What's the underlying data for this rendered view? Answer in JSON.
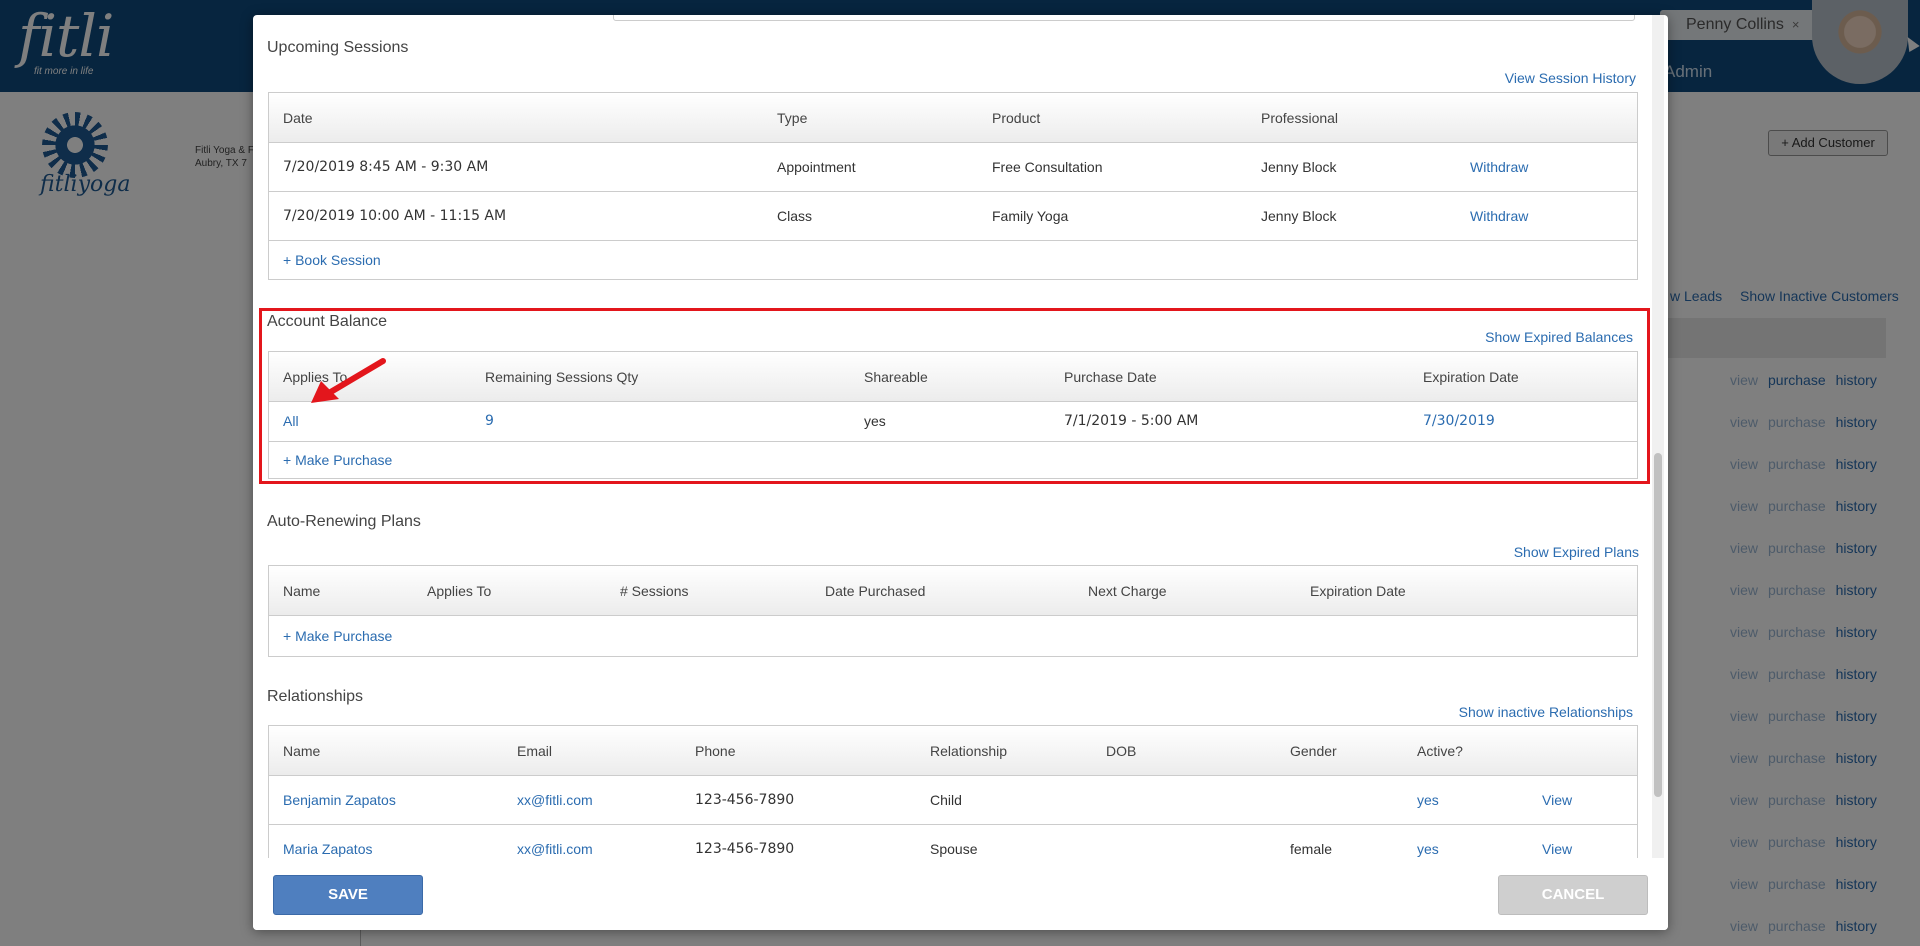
{
  "background": {
    "brand": "fitli",
    "brand_tagline": "fit more in life",
    "user_name": "Penny Collins",
    "user_close": "×",
    "admin_label": "Admin",
    "studio_logo_text": "fitliyoga",
    "studio_address_line1": "Fitli Yoga & F",
    "studio_address_line2": "Aubry, TX 7",
    "add_customer": "+ Add Customer",
    "filter_leads": "w Leads",
    "filter_inactive": "Show Inactive Customers",
    "row_actions": {
      "view": "view",
      "purchase": "purchase",
      "history": "history"
    },
    "row_count": 14,
    "colors": {
      "topbar": "#0e4a7e"
    }
  },
  "upcoming_sessions": {
    "title": "Upcoming Sessions",
    "history_link": "View Session History",
    "columns": [
      "Date",
      "Type",
      "Product",
      "Professional"
    ],
    "rows": [
      {
        "date": "7/20/2019 8:45 AM - 9:30 AM",
        "type": "Appointment",
        "product": "Free Consultation",
        "professional": "Jenny Block",
        "action": "Withdraw"
      },
      {
        "date": "7/20/2019 10:00 AM - 11:15 AM",
        "type": "Class",
        "product": "Family Yoga",
        "professional": "Jenny Block",
        "action": "Withdraw"
      }
    ],
    "book_link": "+ Book Session"
  },
  "account_balance": {
    "title": "Account Balance",
    "expired_link": "Show Expired Balances",
    "columns": [
      "Applies To",
      "Remaining Sessions Qty",
      "Shareable",
      "Purchase Date",
      "Expiration Date"
    ],
    "rows": [
      {
        "applies_to": "All",
        "remaining": "9",
        "shareable": "yes",
        "purchase_date": "7/1/2019 - 5:00 AM",
        "expiration_date": "7/30/2019"
      }
    ],
    "purchase_link": "+ Make Purchase"
  },
  "auto_renewing": {
    "title": "Auto-Renewing Plans",
    "expired_link": "Show Expired Plans",
    "columns": [
      "Name",
      "Applies To",
      "# Sessions",
      "Date Purchased",
      "Next Charge",
      "Expiration Date"
    ],
    "purchase_link": "+ Make Purchase"
  },
  "relationships": {
    "title": "Relationships",
    "inactive_link": "Show inactive Relationships",
    "columns": [
      "Name",
      "Email",
      "Phone",
      "Relationship",
      "DOB",
      "Gender",
      "Active?"
    ],
    "rows": [
      {
        "name": "Benjamin Zapatos",
        "email": "xx@fitli.com",
        "phone": "123-456-7890",
        "relationship": "Child",
        "dob": "",
        "gender": "",
        "active": "yes",
        "action": "View"
      },
      {
        "name": "Maria Zapatos",
        "email": "xx@fitli.com",
        "phone": "123-456-7890",
        "relationship": "Spouse",
        "dob": "",
        "gender": "female",
        "active": "yes",
        "action": "View"
      }
    ]
  },
  "footer": {
    "save": "SAVE",
    "cancel": "CANCEL"
  },
  "annotation": {
    "highlight_color": "#e3161c",
    "arrow_color": "#e3161c"
  }
}
